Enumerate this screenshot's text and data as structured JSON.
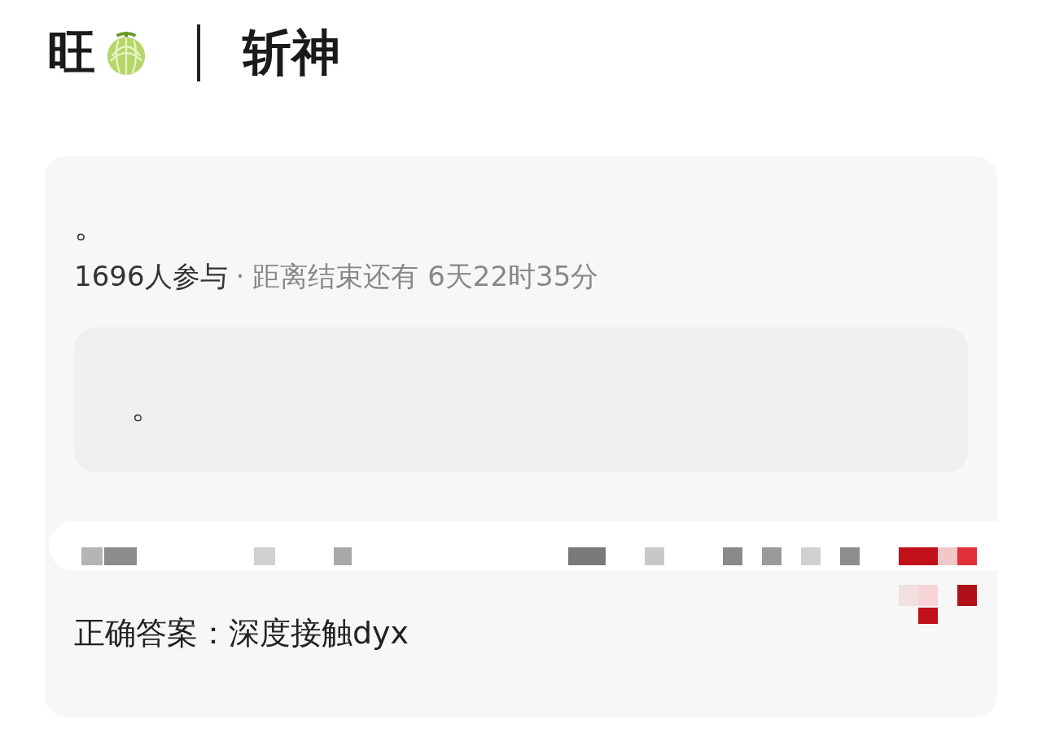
{
  "header": {
    "name": "旺",
    "title": "斩神"
  },
  "card": {
    "question": "。",
    "participants": "1696人参与",
    "separator": "·",
    "countdown": "距离结束还有 6天22时35分",
    "option": "。",
    "answer": "正确答案：深度接触dyx"
  }
}
